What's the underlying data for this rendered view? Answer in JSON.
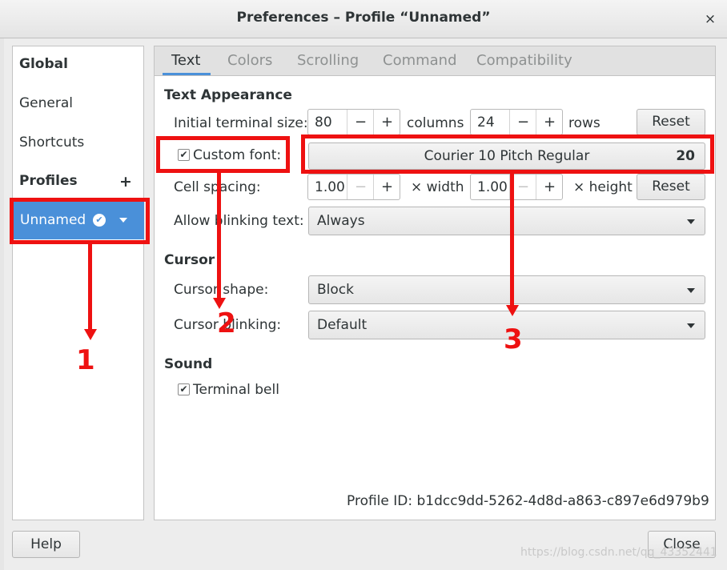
{
  "window": {
    "title": "Preferences – Profile “Unnamed”",
    "close_glyph": "×"
  },
  "sidebar": {
    "global": "Global",
    "general": "General",
    "shortcuts": "Shortcuts",
    "profiles": "Profiles",
    "add_glyph": "+",
    "selected_profile": "Unnamed",
    "check_glyph": "✔"
  },
  "tabs": [
    "Text",
    "Colors",
    "Scrolling",
    "Command",
    "Compatibility"
  ],
  "text_appearance": {
    "heading": "Text Appearance",
    "initial_size_label": "Initial terminal size:",
    "columns_value": "80",
    "columns_unit": "columns",
    "rows_value": "24",
    "rows_unit": "rows",
    "reset_label": "Reset",
    "custom_font_label": "Custom font:",
    "custom_font_checked": true,
    "font_name": "Courier 10 Pitch Regular",
    "font_size": "20",
    "cell_spacing_label": "Cell spacing:",
    "width_value": "1.00",
    "width_unit": "× width",
    "height_value": "1.00",
    "height_unit": "× height",
    "reset2_label": "Reset",
    "blink_text_label": "Allow blinking text:",
    "blink_text_value": "Always",
    "minus_glyph": "−",
    "plus_glyph": "+"
  },
  "cursor": {
    "heading": "Cursor",
    "shape_label": "Cursor shape:",
    "shape_value": "Block",
    "blinking_label": "Cursor blinking:",
    "blinking_value": "Default"
  },
  "sound": {
    "heading": "Sound",
    "bell_label": "Terminal bell",
    "bell_checked": true
  },
  "profile_id": "Profile ID: b1dcc9dd-5262-4d8d-a863-c897e6d979b9",
  "footer": {
    "help": "Help",
    "close": "Close"
  },
  "annotations": {
    "one": "1",
    "two": "2",
    "three": "3",
    "color": "#ee1111"
  },
  "watermark": "https://blog.csdn.net/qq_43352441"
}
